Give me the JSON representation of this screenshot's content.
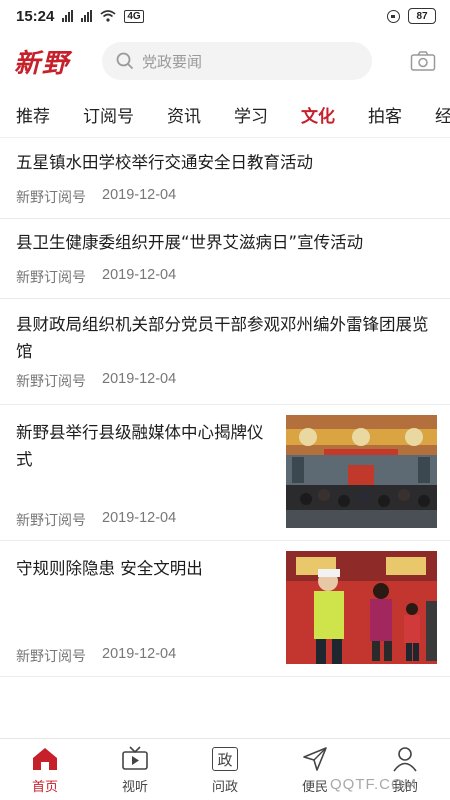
{
  "status_bar": {
    "time": "15:24",
    "network": "4G",
    "battery": "87"
  },
  "header": {
    "logo": "新野",
    "search_placeholder": "党政要闻"
  },
  "tabs": [
    {
      "label": "推荐"
    },
    {
      "label": "订阅号"
    },
    {
      "label": "资讯"
    },
    {
      "label": "学习"
    },
    {
      "label": "文化",
      "active": true
    },
    {
      "label": "拍客"
    },
    {
      "label": "经济"
    }
  ],
  "feed": [
    {
      "title": "五星镇水田学校举行交通安全日教育活动",
      "source": "新野订阅号",
      "date": "2019-12-04"
    },
    {
      "title": "县卫生健康委组织开展“世界艾滋病日”宣传活动",
      "source": "新野订阅号",
      "date": "2019-12-04"
    },
    {
      "title": "县财政局组织机关部分党员干部参观邓州编外雷锋团展览馆",
      "source": "新野订阅号",
      "date": "2019-12-04"
    },
    {
      "title": "新野县举行县级融媒体中心揭牌仪式",
      "source": "新野订阅号",
      "date": "2019-12-04",
      "image": "media-center-unveiling-photo"
    },
    {
      "title": "守规则除隐患 安全文明出",
      "source": "新野订阅号",
      "date": "2019-12-04",
      "image": "traffic-police-children-photo"
    }
  ],
  "bottom_nav": [
    {
      "label": "首页",
      "icon": "home-icon",
      "active": true
    },
    {
      "label": "视听",
      "icon": "tv-icon"
    },
    {
      "label": "问政",
      "icon": "wenzheng-icon",
      "glyph": "政"
    },
    {
      "label": "便民",
      "icon": "send-icon"
    },
    {
      "label": "我的",
      "icon": "user-icon"
    }
  ],
  "watermark": "QQTF.COM",
  "colors": {
    "accent": "#c6202b",
    "text": "#1c1c1c",
    "meta": "#777777"
  }
}
